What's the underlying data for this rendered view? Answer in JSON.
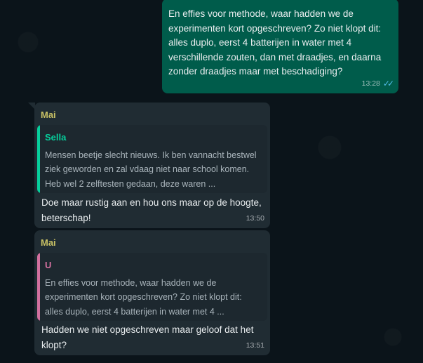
{
  "outgoing": {
    "text": "En effies voor methode, waar hadden we de experimenten kort opgeschreven? Zo niet klopt dit: alles duplo, eerst 4 batterijen in water met 4 verschillende zouten, dan met draadjes, en daarna zonder draadjes maar met beschadiging?",
    "time": "13:28",
    "status_icon": "double-check-read"
  },
  "messages": [
    {
      "sender": "Mai",
      "quote_author": "Sella",
      "quote_text": "Mensen beetje slecht nieuws. Ik ben vannacht bestwel ziek geworden en zal vdaag niet naar school komen. Heb wel 2 zelftesten gedaan, deze waren ...",
      "text": "Doe maar rustig aan en hou ons maar op de hoogte, beterschap!",
      "time": "13:50"
    },
    {
      "sender": "Mai",
      "quote_author": "U",
      "quote_text": "En effies voor methode, waar hadden we de experimenten kort opgeschreven? Zo niet klopt dit: alles duplo, eerst 4 batterijen in water met 4 ...",
      "text": "Hadden we niet opgeschreven maar geloof dat het klopt?",
      "time": "13:51"
    }
  ],
  "colors": {
    "outgoing_bubble": "#005c4b",
    "incoming_bubble": "#202c33",
    "sender_name": "#c8c165",
    "quote_green": "#06cf9c",
    "quote_pink": "#d3709f",
    "read_ticks": "#53bdeb"
  }
}
